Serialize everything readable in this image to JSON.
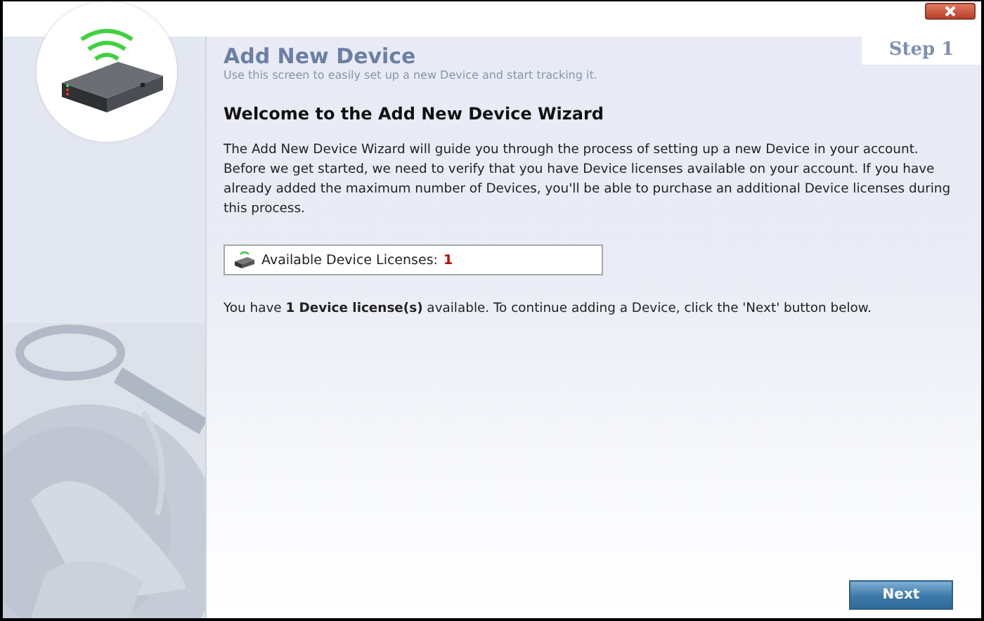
{
  "header": {
    "title": "Add New Device",
    "subtitle": "Use this screen to easily set up a new Device and start tracking it.",
    "step": "Step 1"
  },
  "content": {
    "heading": "Welcome to the Add New Device Wizard",
    "intro": "The Add New Device Wizard will guide you through the process of setting up a new Device in your account. Before we get started, we need to verify that you have Device licenses available on your account. If you have already added the maximum number of Devices, you'll be able to purchase an additional Device licenses during this process.",
    "license_box": {
      "label": "Available Device Licenses:",
      "count": "1"
    },
    "status": "You have **1 Device license(s)** available. To continue adding a Device, click the 'Next' button below."
  },
  "buttons": [
    {
      "label": "Next"
    }
  ]
}
